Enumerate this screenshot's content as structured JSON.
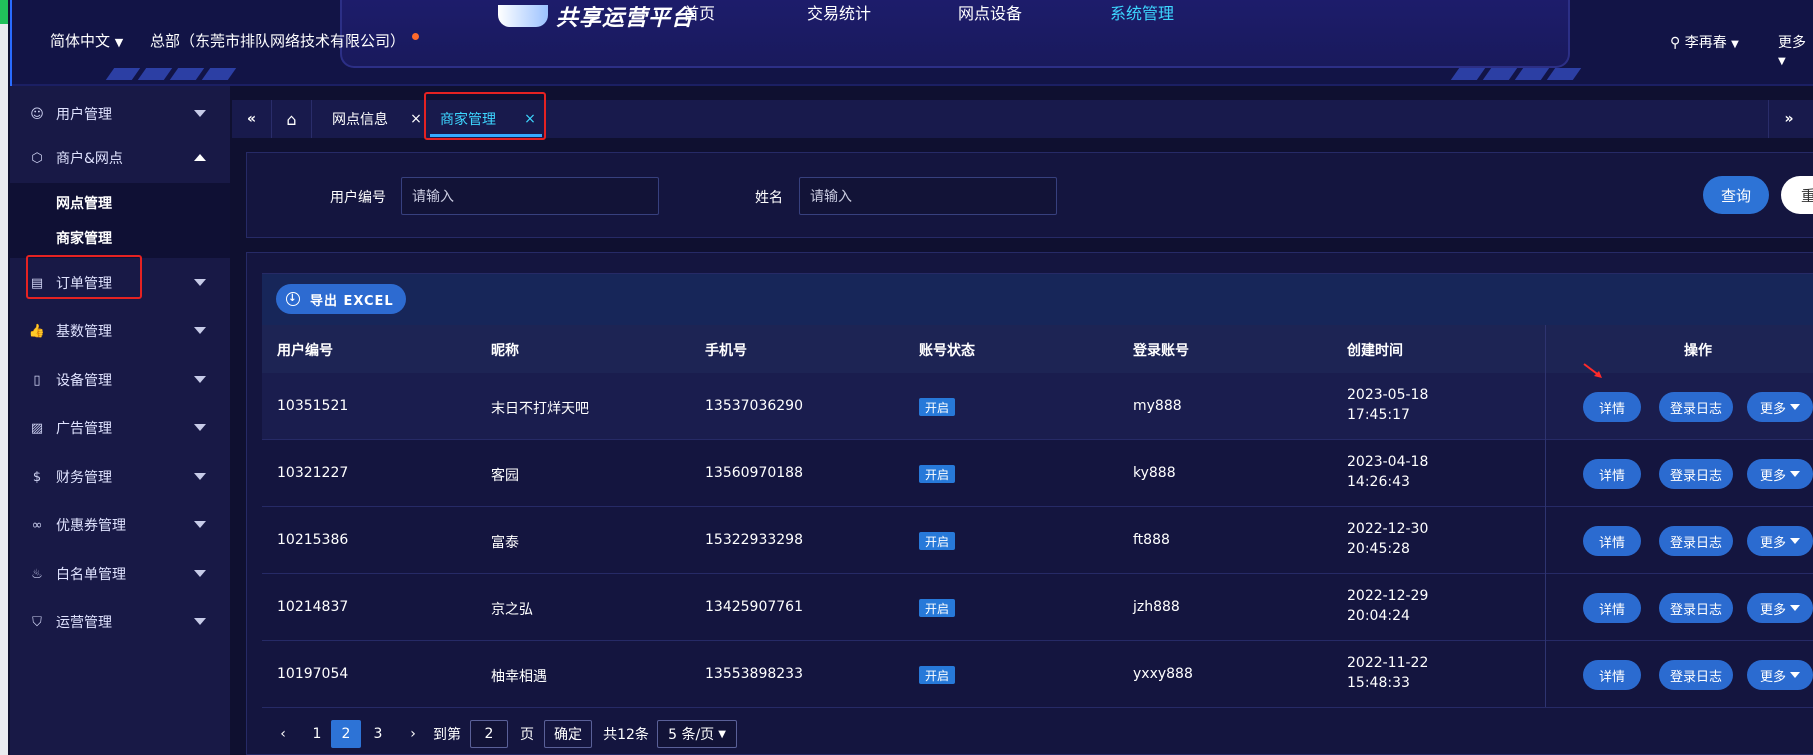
{
  "header": {
    "language": "简体中文",
    "organization": "总部（东莞市排队网络技术有限公司）",
    "logo_text": "共享运营平台",
    "nav": [
      "首页",
      "交易统计",
      "网点设备",
      "系统管理"
    ],
    "active_nav": "系统管理",
    "user_name": "李再春",
    "more_label": "更多"
  },
  "sidebar": {
    "items": [
      {
        "label": "用户管理",
        "icon": "user-icon"
      },
      {
        "label": "商户&网点",
        "icon": "cube-icon",
        "expanded": true
      },
      {
        "label": "订单管理",
        "icon": "clipboard-icon"
      },
      {
        "label": "基数管理",
        "icon": "thumbs-up-icon"
      },
      {
        "label": "设备管理",
        "icon": "phone-icon"
      },
      {
        "label": "广告管理",
        "icon": "image-icon"
      },
      {
        "label": "财务管理",
        "icon": "dollar-icon"
      },
      {
        "label": "优惠券管理",
        "icon": "coupon-icon"
      },
      {
        "label": "白名单管理",
        "icon": "flame-icon"
      },
      {
        "label": "运营管理",
        "icon": "shield-icon"
      }
    ],
    "subitems": [
      "网点管理",
      "商家管理"
    ]
  },
  "tabs": {
    "items": [
      "网点信息",
      "商家管理"
    ],
    "active": "商家管理",
    "close_glyph": "×"
  },
  "search": {
    "user_id_label": "用户编号",
    "user_id_placeholder": "请输入",
    "name_label": "姓名",
    "name_placeholder": "请输入",
    "query_button": "查询",
    "reset_button": "重"
  },
  "table": {
    "export_label": "导出 EXCEL",
    "columns": [
      "用户编号",
      "昵称",
      "手机号",
      "账号状态",
      "登录账号",
      "创建时间",
      "操作"
    ],
    "rows": [
      {
        "id": "10351521",
        "nickname": "末日不打烊天吧",
        "phone": "13537036290",
        "status": "开启",
        "account": "my888",
        "date": "2023-05-18",
        "time": "17:45:17"
      },
      {
        "id": "10321227",
        "nickname": "客园",
        "phone": "13560970188",
        "status": "开启",
        "account": "ky888",
        "date": "2023-04-18",
        "time": "14:26:43"
      },
      {
        "id": "10215386",
        "nickname": "富泰",
        "phone": "15322933298",
        "status": "开启",
        "account": "ft888",
        "date": "2022-12-30",
        "time": "20:45:28"
      },
      {
        "id": "10214837",
        "nickname": "京之弘",
        "phone": "13425907761",
        "status": "开启",
        "account": "jzh888",
        "date": "2022-12-29",
        "time": "20:04:24"
      },
      {
        "id": "10197054",
        "nickname": "柚幸相遇",
        "phone": "13553898233",
        "status": "开启",
        "account": "yxxy888",
        "date": "2022-11-22",
        "time": "15:48:33"
      }
    ],
    "actions": {
      "detail": "详情",
      "login_log": "登录日志",
      "more": "更多"
    }
  },
  "pagination": {
    "pages": [
      "1",
      "2",
      "3"
    ],
    "current_page": "2",
    "goto_label": "到第",
    "goto_value": "2",
    "page_unit": "页",
    "confirm_label": "确定",
    "total_label": "共12条",
    "page_size": "5 条/页"
  },
  "colors": {
    "accent": "#2d73d6",
    "active_nav": "#3dd6ff",
    "highlight_box": "#e52222",
    "background": "#0f1030"
  }
}
